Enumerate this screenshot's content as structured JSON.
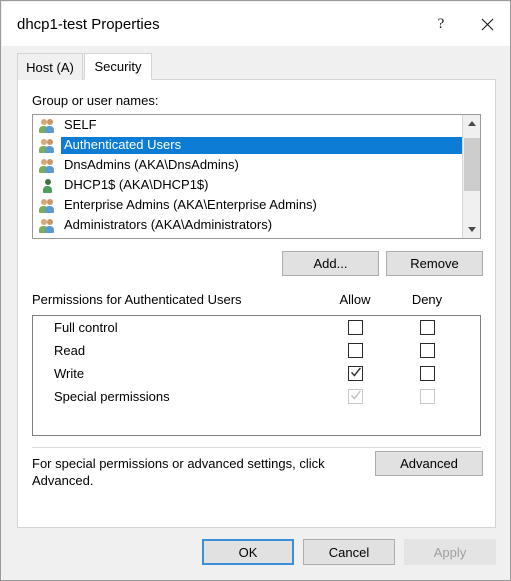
{
  "window": {
    "title": "dhcp1-test Properties",
    "help_icon": "question-mark-icon",
    "close_icon": "close-icon"
  },
  "tabs": [
    {
      "label": "Host (A)",
      "active": false
    },
    {
      "label": "Security",
      "active": true
    }
  ],
  "security": {
    "group_names_label": "Group or user names:",
    "entries": [
      {
        "name": "SELF",
        "icon": "group-icon",
        "selected": false
      },
      {
        "name": "Authenticated Users",
        "icon": "group-icon",
        "selected": true
      },
      {
        "name": "DnsAdmins (AKA\\DnsAdmins)",
        "icon": "group-icon",
        "selected": false
      },
      {
        "name": "DHCP1$ (AKA\\DHCP1$)",
        "icon": "user-icon",
        "selected": false
      },
      {
        "name": "Enterprise Admins (AKA\\Enterprise Admins)",
        "icon": "group-icon",
        "selected": false
      },
      {
        "name": "Administrators (AKA\\Administrators)",
        "icon": "group-icon",
        "selected": false
      }
    ],
    "scrollbar": {
      "up_icon": "chevron-up-icon",
      "down_icon": "chevron-down-icon"
    },
    "add_label": "Add...",
    "remove_label": "Remove",
    "permissions_header": "Permissions for Authenticated Users",
    "column_allow": "Allow",
    "column_deny": "Deny",
    "permissions": [
      {
        "label": "Full control",
        "allow": "unchecked",
        "deny": "unchecked",
        "disabled": false
      },
      {
        "label": "Read",
        "allow": "unchecked",
        "deny": "unchecked",
        "disabled": false
      },
      {
        "label": "Write",
        "allow": "checked",
        "deny": "unchecked",
        "disabled": false
      },
      {
        "label": "Special permissions",
        "allow": "checked",
        "deny": "unchecked",
        "disabled": true
      }
    ],
    "advanced_note": "For special permissions or advanced settings, click Advanced.",
    "advanced_label": "Advanced"
  },
  "footer": {
    "ok_label": "OK",
    "cancel_label": "Cancel",
    "apply_label": "Apply",
    "apply_enabled": false
  },
  "colors": {
    "selection_blue": "#0c7cd5",
    "focus_blue": "#3b8fd4",
    "dialog_bg": "#f0f0f0",
    "panel_bg": "#ffffff"
  }
}
